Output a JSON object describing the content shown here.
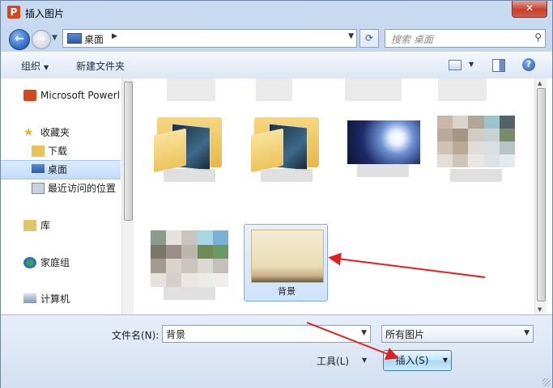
{
  "window": {
    "title": "插入图片",
    "app_icon_letter": "P",
    "close_glyph": "✕"
  },
  "nav": {
    "address_path": "桌面",
    "search_placeholder": "搜索 桌面"
  },
  "toolbar": {
    "organize_label": "组织",
    "new_folder_label": "新建文件夹"
  },
  "sidebar": {
    "items": [
      {
        "label": "Microsoft Powerl",
        "icon": "powerpoint-icon"
      },
      {
        "label": "收藏夹",
        "icon": "favorites-star-icon"
      },
      {
        "label": "下载",
        "icon": "downloads-icon"
      },
      {
        "label": "桌面",
        "icon": "desktop-icon",
        "selected": true
      },
      {
        "label": "最近访问的位置",
        "icon": "recent-places-icon"
      },
      {
        "label": "库",
        "icon": "library-icon"
      },
      {
        "label": "家庭组",
        "icon": "homegroup-icon"
      },
      {
        "label": "计算机",
        "icon": "computer-icon"
      }
    ]
  },
  "files": {
    "items": [
      {
        "name": "",
        "kind": "folder",
        "label_obscured": true
      },
      {
        "name": "",
        "kind": "folder",
        "label_obscured": true
      },
      {
        "name": "",
        "kind": "image-moon",
        "label_obscured": true
      },
      {
        "name": "",
        "kind": "image-mosaic",
        "label_obscured": true
      },
      {
        "name": "",
        "kind": "image-mosaic",
        "label_obscured": true
      },
      {
        "name": "背景",
        "kind": "image-background",
        "selected": true
      }
    ]
  },
  "footer": {
    "filename_label": "文件名(N):",
    "filename_value": "背景",
    "filetype_value": "所有图片",
    "tools_label": "工具(L)",
    "insert_label": "插入(S)"
  },
  "colors": {
    "annotation_arrow": "#e02020",
    "selection": "#cfe3fb",
    "folder": "#edc35c"
  }
}
